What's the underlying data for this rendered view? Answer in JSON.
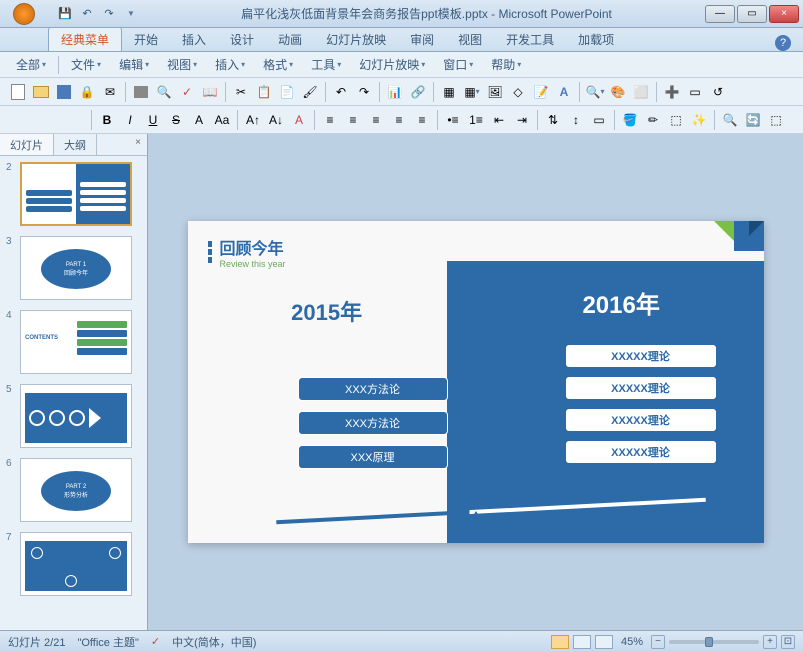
{
  "titlebar": {
    "title": "扁平化浅灰低面背景年会商务报告ppt模板.pptx - Microsoft PowerPoint"
  },
  "qat": {
    "save": "💾",
    "undo": "↶",
    "redo": "↷"
  },
  "winControls": {
    "min": "—",
    "max": "▭",
    "close": "×"
  },
  "ribbonTabs": [
    "经典菜单",
    "开始",
    "插入",
    "设计",
    "动画",
    "幻灯片放映",
    "审阅",
    "视图",
    "开发工具",
    "加载项"
  ],
  "menuRow": [
    "全部",
    "文件",
    "编辑",
    "视图",
    "插入",
    "格式",
    "工具",
    "幻灯片放映",
    "窗口",
    "帮助"
  ],
  "formatBtns": {
    "bold": "B",
    "italic": "I",
    "underline": "U",
    "strike": "S",
    "shadow": "A",
    "highlight": "Aa"
  },
  "panelTabs": {
    "slides": "幻灯片",
    "outline": "大纲",
    "close": "×"
  },
  "thumbNums": [
    "2",
    "3",
    "4",
    "5",
    "6",
    "7"
  ],
  "thumb3": {
    "line1": "PART 1",
    "line2": "回顾今年"
  },
  "thumb4": "CONTENTS",
  "thumb6": {
    "line1": "PART 2",
    "line2": "形势分析"
  },
  "slide": {
    "title": "回顾今年",
    "subtitle": "Review this year",
    "yearLeft": "2015年",
    "yearRight": "2016年",
    "leftBoxes": [
      "XXX方法论",
      "XXX方法论",
      "XXX原理"
    ],
    "rightBoxes": [
      "XXXXX理论",
      "XXXXX理论",
      "XXXXX理论",
      "XXXXX理论"
    ]
  },
  "statusbar": {
    "slideInfo": "幻灯片 2/21",
    "theme": "\"Office 主题\"",
    "lang": "中文(简体，中国)",
    "zoom": "45%",
    "minus": "−",
    "plus": "+",
    "fit": "⊡"
  }
}
